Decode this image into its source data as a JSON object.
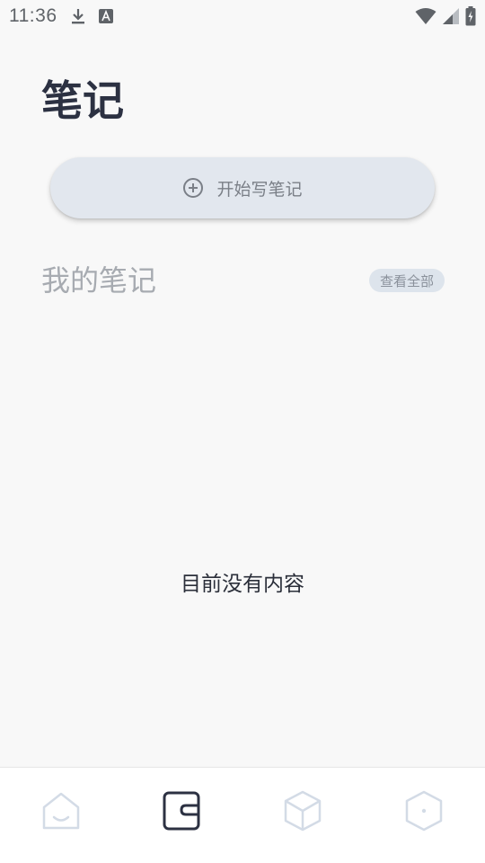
{
  "status_bar": {
    "time": "11:36",
    "icons": [
      "download-icon",
      "text-a-icon",
      "wifi-icon",
      "signal-icon",
      "battery-charging-icon"
    ]
  },
  "header": {
    "title": "笔记"
  },
  "start_button": {
    "label": "开始写笔记",
    "icon": "plus-circle-icon"
  },
  "section": {
    "title": "我的笔记",
    "view_all_label": "查看全部"
  },
  "empty_state": {
    "message": "目前没有内容"
  },
  "bottom_nav": {
    "items": [
      {
        "icon": "home-icon",
        "active": false
      },
      {
        "icon": "notes-icon",
        "active": true
      },
      {
        "icon": "cube-icon",
        "active": false
      },
      {
        "icon": "hexagon-icon",
        "active": false
      }
    ]
  },
  "colors": {
    "title": "#2c3142",
    "muted": "#a7abb1",
    "button_bg": "#e2e7ee",
    "chip_bg": "#dde4ec",
    "nav_active": "#2c3142",
    "nav_inactive": "#d3dbe6"
  }
}
